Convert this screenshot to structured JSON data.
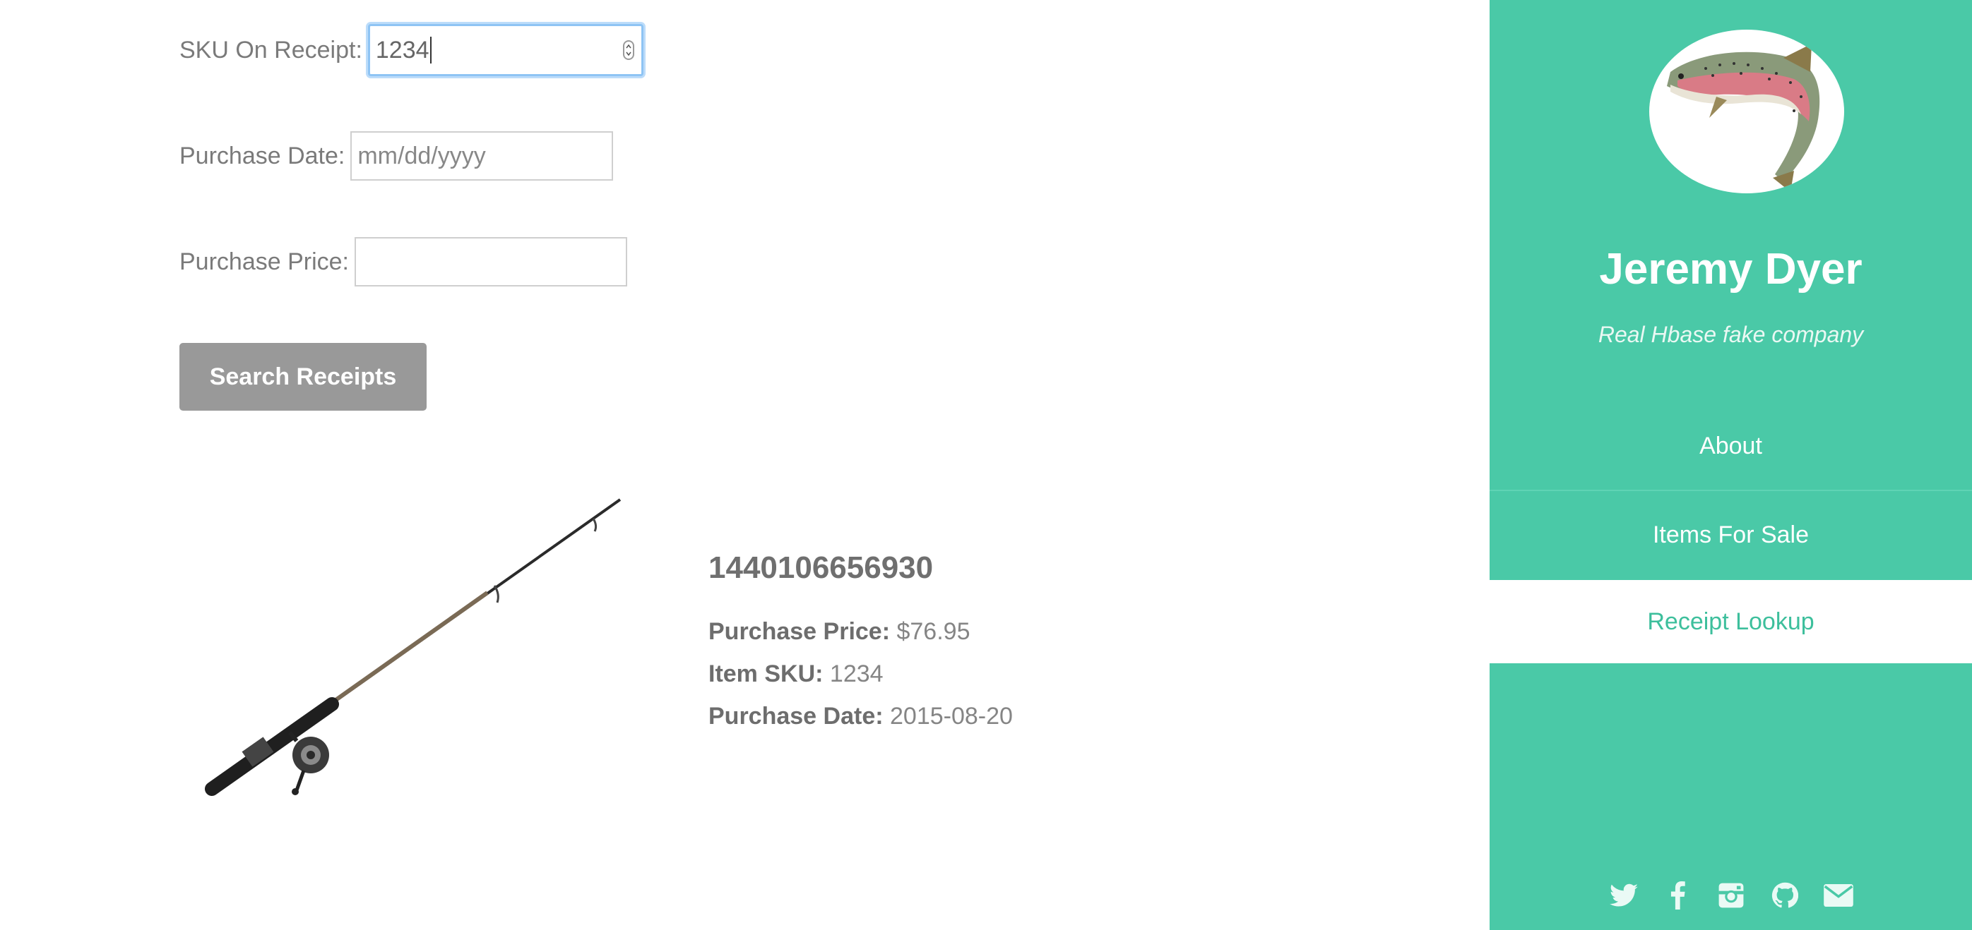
{
  "form": {
    "sku_label": "SKU On Receipt:",
    "sku_value": "1234",
    "date_label": "Purchase Date:",
    "date_placeholder": "mm/dd/yyyy",
    "price_label": "Purchase Price:",
    "price_value": "",
    "search_button": "Search Receipts"
  },
  "result": {
    "id": "1440106656930",
    "price_label": "Purchase Price:",
    "price_value": "$76.95",
    "sku_label": "Item SKU:",
    "sku_value": "1234",
    "date_label": "Purchase Date:",
    "date_value": "2015-08-20"
  },
  "sidebar": {
    "name": "Jeremy Dyer",
    "tagline": "Real Hbase fake company",
    "nav": {
      "about": "About",
      "items": "Items For Sale",
      "receipt": "Receipt Lookup"
    },
    "social_icons": [
      "twitter-icon",
      "facebook-icon",
      "instagram-icon",
      "github-icon",
      "email-icon"
    ],
    "accent_color": "#4ac9a7"
  }
}
